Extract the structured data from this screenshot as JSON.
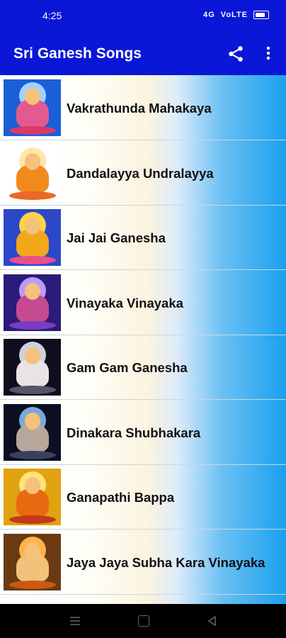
{
  "status_bar": {
    "time": "4:25",
    "network_text": "4G",
    "wifi_text": "VoLTE",
    "battery_level": 0.8
  },
  "app_bar": {
    "title": "Sri Ganesh Songs",
    "share_icon": "share-icon",
    "more_icon": "more-vert-icon"
  },
  "songs": [
    {
      "title": "Vakrathunda Mahakaya",
      "bg": "#1a5fd6",
      "halo": "#9fd2ff",
      "body": "#e35a8f",
      "base": "#d83a6a"
    },
    {
      "title": "Dandalayya Undralayya",
      "bg": "#ffffff",
      "halo": "#ffe6a8",
      "body": "#f08a1c",
      "base": "#e86a24"
    },
    {
      "title": "Jai Jai Ganesha",
      "bg": "#2b48c8",
      "halo": "#ffd24a",
      "body": "#f2a81d",
      "base": "#e8508a"
    },
    {
      "title": "Vinayaka Vinayaka",
      "bg": "#2a1c7a",
      "halo": "#b99cff",
      "body": "#c64a8f",
      "base": "#7a3cc0"
    },
    {
      "title": "Gam Gam Ganesha",
      "bg": "#0e0e1e",
      "halo": "#cfcfe0",
      "body": "#e9e2e6",
      "base": "#555566"
    },
    {
      "title": "Dinakara Shubhakara",
      "bg": "#0a0f22",
      "halo": "#7aa9d8",
      "body": "#b8a89c",
      "base": "#3a4058"
    },
    {
      "title": "Ganapathi Bappa",
      "bg": "#e0a210",
      "halo": "#ffe37a",
      "body": "#e86a10",
      "base": "#c0391b"
    },
    {
      "title": "Jaya Jaya Subha Kara Vinayaka",
      "bg": "#6a3a12",
      "halo": "#ffb347",
      "body": "#f1c27a",
      "base": "#c85a12"
    }
  ],
  "nav_bar": {
    "menu_icon": "recents-icon",
    "home_icon": "home-icon",
    "back_icon": "back-icon"
  }
}
